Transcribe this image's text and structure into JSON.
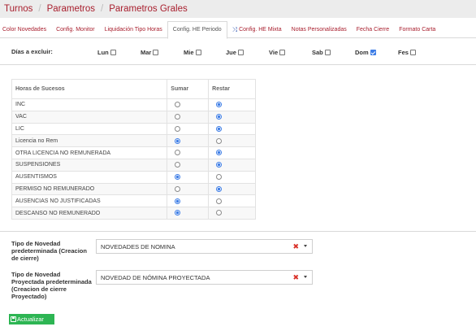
{
  "breadcrumb": [
    "Turnos",
    "Parametros",
    "Parametros Grales"
  ],
  "tabs": [
    {
      "label": "Color Novedades",
      "active": false
    },
    {
      "label": "Config. Monitor",
      "active": false
    },
    {
      "label": "Liquidación Tipo Horas",
      "active": false
    },
    {
      "label": "Config. HE Periodo",
      "active": true
    },
    {
      "label": "Config. HE Mixta",
      "active": false,
      "icon": "shuffle-icon"
    },
    {
      "label": "Notas Personalizadas",
      "active": false
    },
    {
      "label": "Fecha Cierre",
      "active": false
    },
    {
      "label": "Formato Carta",
      "active": false
    }
  ],
  "days": {
    "label": "Días a excluir:",
    "items": [
      {
        "label": "Lun",
        "checked": false
      },
      {
        "label": "Mar",
        "checked": false
      },
      {
        "label": "Mie",
        "checked": false
      },
      {
        "label": "Jue",
        "checked": false
      },
      {
        "label": "Vie",
        "checked": false
      },
      {
        "label": "Sab",
        "checked": false
      },
      {
        "label": "Dom",
        "checked": true
      },
      {
        "label": "Fes",
        "checked": false
      }
    ]
  },
  "hours_table": {
    "headers": [
      "Horas de Sucesos",
      "Sumar",
      "Restar"
    ],
    "rows": [
      {
        "name": "INC",
        "selected": "Restar"
      },
      {
        "name": "VAC",
        "selected": "Restar"
      },
      {
        "name": "LIC",
        "selected": "Restar"
      },
      {
        "name": "Licencia no Rem",
        "selected": "Sumar"
      },
      {
        "name": "OTRA LICENCIA NO REMUNERADA",
        "selected": "Restar"
      },
      {
        "name": "SUSPENSIONES",
        "selected": "Restar"
      },
      {
        "name": "AUSENTISMOS",
        "selected": "Sumar"
      },
      {
        "name": "PERMISO NO REMUNERADO",
        "selected": "Restar"
      },
      {
        "name": "AUSENCIAS NO JUSTIFICADAS",
        "selected": "Sumar"
      },
      {
        "name": "DESCANSO NO REMUNERADO",
        "selected": "Sumar"
      }
    ]
  },
  "fields": {
    "tipo_novedad": {
      "label": "Tipo de Novedad predeterminada (Creacion de cierre)",
      "value": "NOVEDADES DE NOMINA"
    },
    "tipo_novedad_proyectada": {
      "label": "Tipo de Novedad Proyectada predeterminada (Creacion de cierre Proyectado)",
      "value": "NOVEDAD DE NÓMINA PROYECTADA"
    }
  },
  "actions": {
    "update_label": "Actualizar"
  },
  "colors": {
    "accent": "#a81e2d",
    "radio_blue": "#3d7de6",
    "update_green": "#2db553",
    "clear_red": "#d9322a"
  }
}
